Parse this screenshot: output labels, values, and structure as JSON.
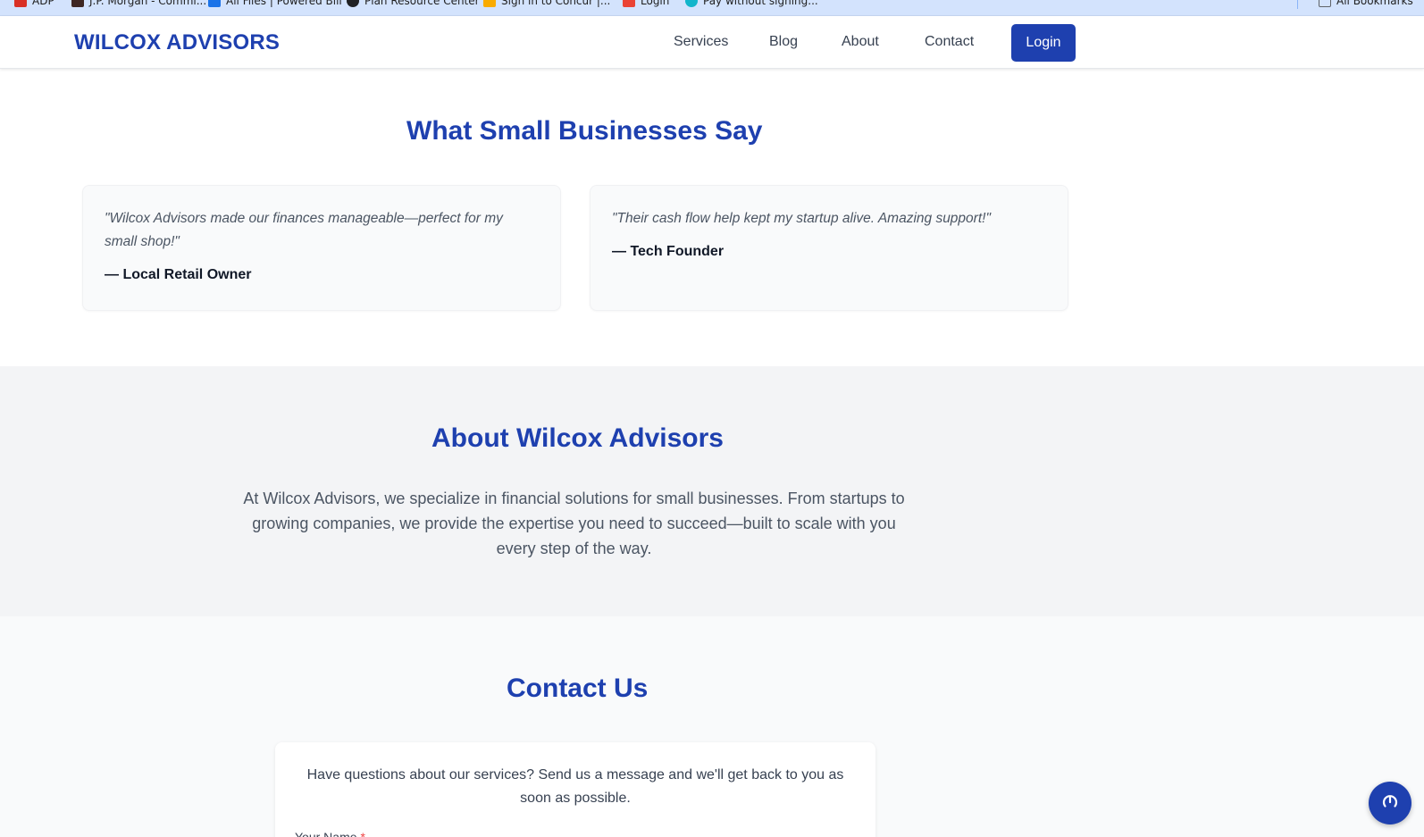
{
  "bookmarks": [
    {
      "label": "ADP",
      "color": "#d93025"
    },
    {
      "label": "J.P. Morgan - Commi...",
      "color": "#3e2723"
    },
    {
      "label": "All Files | Powered Bill",
      "color": "#1a73e8"
    },
    {
      "label": "Plan Resource Center",
      "color": "#202124"
    },
    {
      "label": "Sign in to Concur |...",
      "color": "#f9ab00"
    },
    {
      "label": "Login",
      "color": "#ea4335"
    },
    {
      "label": "Pay without signing...",
      "color": "#12b5cb"
    },
    {
      "label": "All Bookmarks",
      "color": "#5f6368"
    }
  ],
  "header": {
    "brand": "WILCOX ADVISORS",
    "nav": [
      "Services",
      "Blog",
      "About",
      "Contact"
    ],
    "login_label": "Login"
  },
  "testimonials": {
    "title": "What Small Businesses Say",
    "items": [
      {
        "quote": "\"Wilcox Advisors made our finances manageable—perfect for my small shop!\"",
        "author": "— Local Retail Owner"
      },
      {
        "quote": "\"Their cash flow help kept my startup alive. Amazing support!\"",
        "author": "— Tech Founder"
      }
    ]
  },
  "about": {
    "title": "About Wilcox Advisors",
    "body": "At Wilcox Advisors, we specialize in financial solutions for small businesses. From startups to growing companies, we provide the expertise you need to succeed—built to scale with you every step of the way."
  },
  "contact": {
    "title": "Contact Us",
    "intro": "Have questions about our services? Send us a message and we'll get back to you as soon as possible.",
    "name_label": "Your Name",
    "required_mark": "*"
  },
  "colors": {
    "primary": "#1e40af",
    "band_gray": "#f3f4f6"
  },
  "fab_icon": "chat-refresh-icon"
}
